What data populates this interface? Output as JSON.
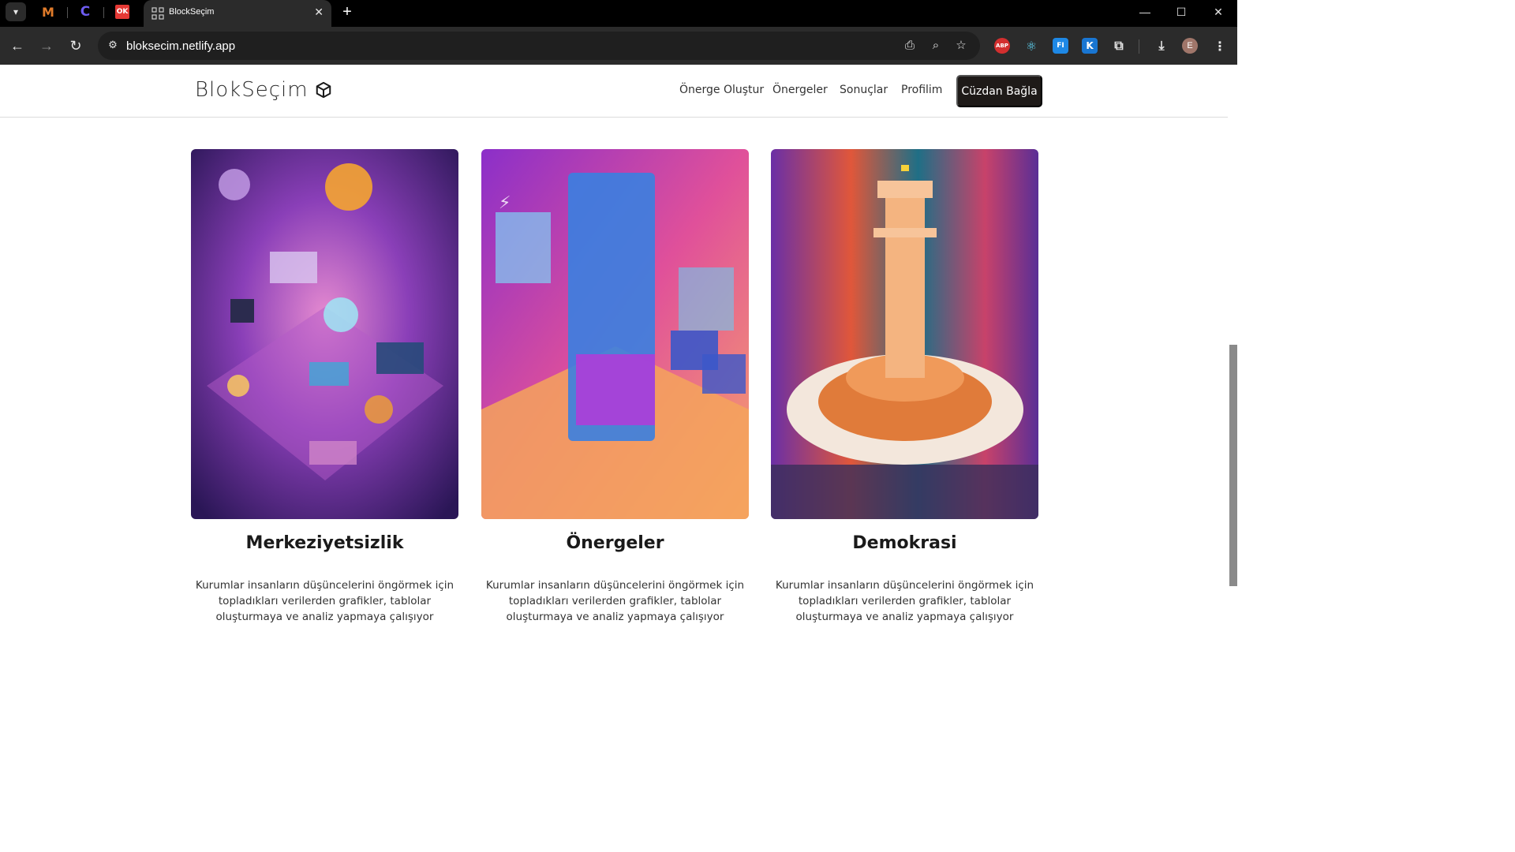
{
  "browser": {
    "active_tab_title": "BlockSeçim",
    "url": "bloksecim.netlify.app",
    "pinned_tabs": [
      "M",
      "C",
      "OK"
    ],
    "extensions": [
      "ABP",
      "react",
      "FI",
      "K",
      "puzzle"
    ],
    "profile_initial": "E"
  },
  "site": {
    "brand": "BlokSeçim",
    "nav": {
      "create": "Önerge Oluştur",
      "proposals": "Önergeler",
      "results": "Sonuçlar",
      "profile": "Profilim",
      "connect_wallet": "Cüzdan Bağla"
    }
  },
  "cards": [
    {
      "title": "Merkeziyetsizlik",
      "text": "Kurumlar insanların düşüncelerini öngörmek için topladıkları verilerden grafikler, tablolar oluşturmaya ve analiz yapmaya çalışıyor"
    },
    {
      "title": "Önergeler",
      "text": "Kurumlar insanların düşüncelerini öngörmek için topladıkları verilerden grafikler, tablolar oluşturmaya ve analiz yapmaya çalışıyor"
    },
    {
      "title": "Demokrasi",
      "text": "Kurumlar insanların düşüncelerini öngörmek için topladıkları verilerden grafikler, tablolar oluşturmaya ve analiz yapmaya çalışıyor"
    }
  ],
  "colors": {
    "cta_bg": "#1e1a18",
    "chrome_dark": "#2b2b2b"
  }
}
